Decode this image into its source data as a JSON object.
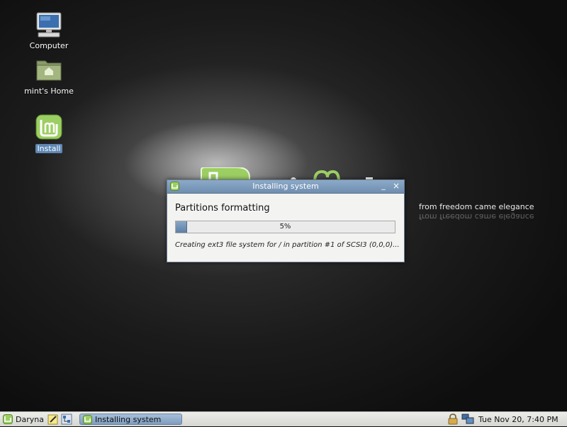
{
  "desktop": {
    "icons": [
      {
        "label": "Computer",
        "icon": "computer-icon"
      },
      {
        "label": "mint's Home",
        "icon": "home-folder-icon"
      },
      {
        "label": "Install",
        "icon": "linux-mint-install-icon"
      }
    ],
    "wallpaper_slogan": "from freedom came elegance"
  },
  "dialog": {
    "title": "Installing system",
    "heading": "Partitions formatting",
    "progress_label": "5%",
    "progress_value": 0.05,
    "status": "Creating ext3 file system for / in partition #1 of SCSI3 (0,0,0)...",
    "minimize_glyph": "_",
    "close_glyph": "×"
  },
  "panel": {
    "menu_label": "Daryna",
    "task_label": "Installing system",
    "clock": "Tue Nov 20,  7:40 PM"
  },
  "colors": {
    "accent": "#6f8eb0",
    "mint_green": "#8cc152"
  }
}
